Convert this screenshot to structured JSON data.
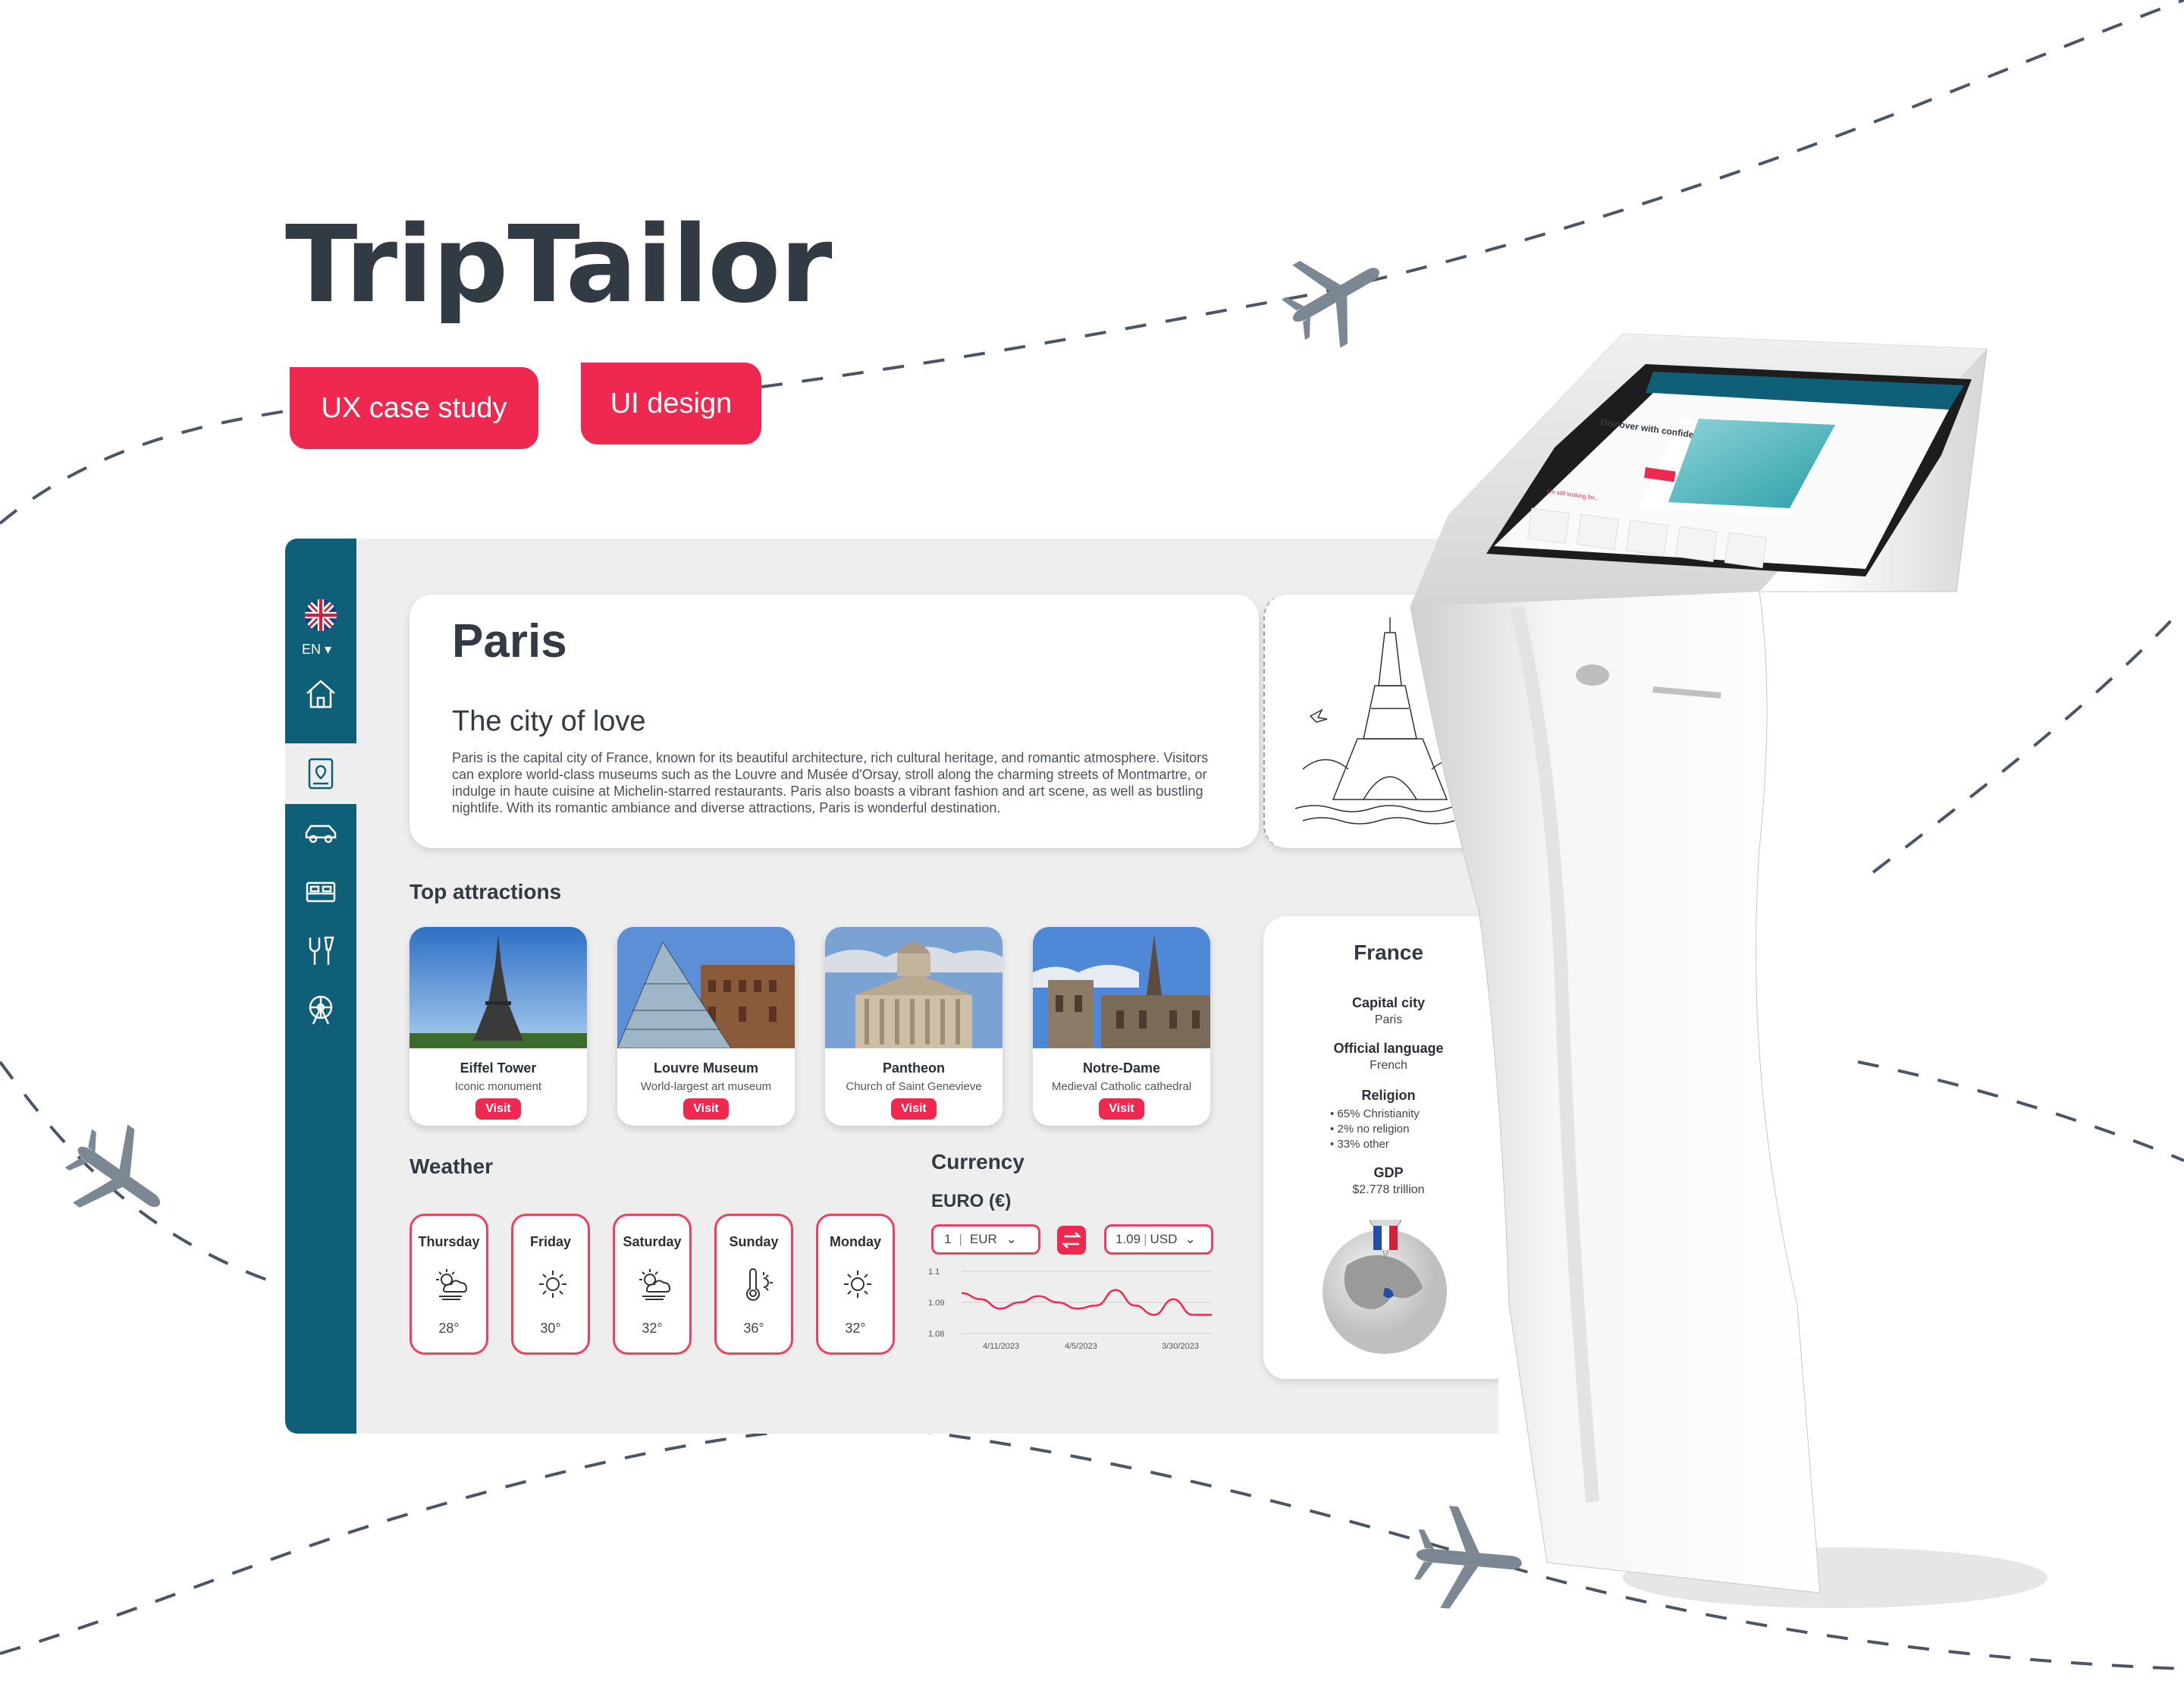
{
  "brand": "TripTailor",
  "tags": [
    "UX case study",
    "UI design"
  ],
  "sidebar": {
    "language": "EN",
    "items": [
      "home-icon",
      "guide-icon",
      "car-icon",
      "bed-icon",
      "dining-icon",
      "attractions-icon"
    ]
  },
  "city": {
    "name": "Paris",
    "tagline": "The city of love",
    "description": "Paris is the capital city of France, known for its beautiful architecture, rich cultural heritage, and romantic atmosphere. Visitors can explore world-class museums such as the Louvre and Musée d'Orsay, stroll along the charming streets of Montmartre, or indulge in haute cuisine at Michelin-starred restaurants. Paris also boasts a vibrant fashion and art scene, as well as bustling nightlife. With its romantic ambiance and diverse attractions, Paris is wonderful destination."
  },
  "attractions": {
    "title": "Top attractions",
    "items": [
      {
        "name": "Eiffel Tower",
        "sub": "Iconic monument",
        "button": "Visit"
      },
      {
        "name": "Louvre Museum",
        "sub": "World-largest art museum",
        "button": "Visit"
      },
      {
        "name": "Pantheon",
        "sub": "Church of Saint Genevieve",
        "button": "Visit"
      },
      {
        "name": "Notre-Dame",
        "sub": "Medieval Catholic cathedral",
        "button": "Visit"
      }
    ]
  },
  "weather": {
    "title": "Weather",
    "days": [
      {
        "day": "Thursday",
        "temp": "28°",
        "icon": "partly-cloudy-icon"
      },
      {
        "day": "Friday",
        "temp": "30°",
        "icon": "sun-icon"
      },
      {
        "day": "Saturday",
        "temp": "32°",
        "icon": "partly-cloudy-icon"
      },
      {
        "day": "Sunday",
        "temp": "36°",
        "icon": "thermometer-icon"
      },
      {
        "day": "Monday",
        "temp": "32°",
        "icon": "sun-icon"
      }
    ]
  },
  "currency": {
    "title": "Currency",
    "base_label": "EURO (€)",
    "from_amount": "1",
    "from_code": "EUR",
    "to_amount": "1.09",
    "to_code": "USD"
  },
  "chart_data": {
    "type": "line",
    "title": "",
    "xlabel": "",
    "ylabel": "",
    "yticks": [
      "1.1",
      "1.09",
      "1.08"
    ],
    "ylim": [
      1.08,
      1.1
    ],
    "xticks": [
      "4/11/2023",
      "4/5/2023",
      "3/30/2023"
    ],
    "series": [
      {
        "values": [
          1.093,
          1.091,
          1.088,
          1.09,
          1.092,
          1.09,
          1.088,
          1.089,
          1.094,
          1.089,
          1.086,
          1.091,
          1.086,
          1.086
        ]
      }
    ],
    "color": "#ef2850"
  },
  "country": {
    "name": "France",
    "capital_label": "Capital city",
    "capital": "Paris",
    "language_label": "Official language",
    "language": "French",
    "religion_label": "Religion",
    "religion": [
      "65% Christianity",
      "2% no religion",
      "33% other"
    ],
    "gdp_label": "GDP",
    "gdp": "$2.778 trillion"
  },
  "kiosk_screen": {
    "title": "Discover with confidence",
    "bottom_label": "I'm still looking for..."
  },
  "colors": {
    "accent": "#ef2850",
    "sidebar": "#0f5f78",
    "text": "#323a44",
    "plane": "#7b8793"
  }
}
